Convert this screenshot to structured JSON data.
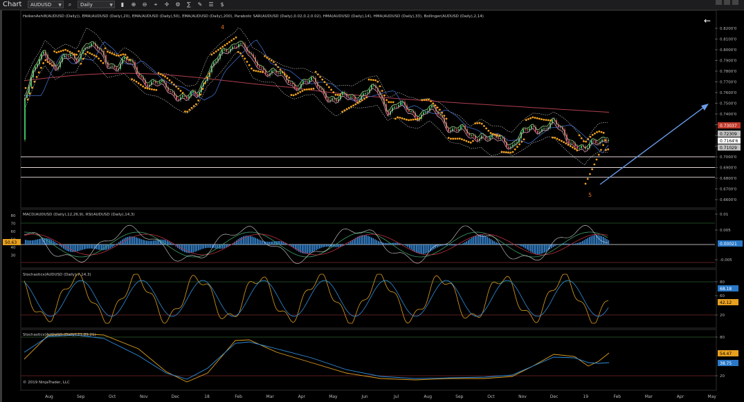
{
  "toolbar": {
    "title": "Chart",
    "instrument": "AUDUSD",
    "period": "Daily"
  },
  "panels": {
    "price": {
      "indicators_label": "HeikenAshi8(AUDUSD (Daily)), EMA(AUDUSD (Daily),20), EMA(AUDUSD (Daily),50), EMA(AUDUSD (Daily),200), Parabolic SAR(AUDUSD (Daily),0.02,0.2,0.02), HMA(AUDUSD (Daily),14), HMA(AUDUSD (Daily),33), Bollinger(AUDUSD (Daily),2,14)",
      "axis_ticks": [
        "0.8200'0",
        "0.8100'0",
        "0.8000'0",
        "0.7900'0",
        "0.7800'0",
        "0.7700'0",
        "0.7600'0",
        "0.7500'0",
        "0.7400'0",
        "0.7300'0",
        "0.7200'0",
        "0.7100'0",
        "0.7000'0",
        "0.6900'0",
        "0.6800'0",
        "0.6700'0",
        "0.6600'0"
      ],
      "price_tags": [
        "0.73037",
        "0.72309",
        "0.7164'6",
        "0.71029"
      ],
      "wave_labels": [
        "4",
        "5"
      ],
      "horizontal_levels": [
        0.7,
        0.69,
        0.681
      ]
    },
    "macd": {
      "label": "MACD(AUDUSD (Daily),12,26,9), RSI(AUDUSD (Daily),14,3)",
      "left_ticks": [
        "80",
        "70",
        "60",
        "50",
        "40",
        "30"
      ],
      "left_value": "50.63",
      "right_ticks": [
        "0.01",
        "0.005",
        "-0.005"
      ],
      "right_value": "0.00021"
    },
    "stoch1": {
      "label": "Stochastics(AUDUSD (Daily),7,14,3)",
      "right_ticks": [
        "80",
        "60",
        "20"
      ],
      "tags": [
        "68.18",
        "42.12"
      ]
    },
    "stoch2": {
      "label": "Stochastics(AUDUSD (Daily),21,89,21)",
      "right_ticks": [
        "80",
        "20"
      ],
      "tags": [
        "54.47",
        "38.75"
      ],
      "copyright": "© 2019 NinjaTrader, LLC"
    }
  },
  "x_axis": {
    "labels": [
      "Aug",
      "Sep",
      "Oct",
      "Nov",
      "Dec",
      "18",
      "Feb",
      "Mar",
      "Apr",
      "May",
      "Jun",
      "Jul",
      "Aug",
      "Sep",
      "Oct",
      "Nov",
      "Dec",
      "19",
      "Feb",
      "Mar",
      "Apr",
      "May"
    ]
  },
  "colors": {
    "background": "#000000",
    "sar": "#f0a020",
    "ema200": "#b04050",
    "stoch_k": "#e0a020",
    "stoch_d": "#3090e0",
    "macd_hist": "#3a90e0",
    "tag_red": "#c0392b",
    "tag_blue": "#2a78c8",
    "tag_orange": "#e8a020",
    "arrow": "#6a9be8"
  }
}
